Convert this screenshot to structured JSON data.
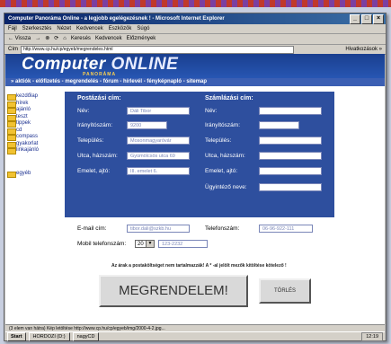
{
  "window": {
    "title": "Computer Panoráma Online - a legjobb egelégezésnek ! - Microsoft Internet Explorer",
    "buttons": [
      "_",
      "□",
      "×"
    ]
  },
  "menu": [
    "Fájl",
    "Szerkesztés",
    "Nézet",
    "Kedvencek",
    "Eszközök",
    "Súgó"
  ],
  "toolbar": [
    "← Vissza",
    "→",
    "⊗",
    "⟳",
    "⌂",
    "Keresés",
    "Kedvencek",
    "Előzmények"
  ],
  "address": {
    "label": "Cím",
    "value": "http://www.cp.hu/cp/egyeb/megrendeles.html",
    "links_label": "Hivatkozások »"
  },
  "banner": {
    "logo_main": "Computer",
    "logo_online": "ONLINE",
    "logo_sub": "PANORÁMA"
  },
  "navbar": "» aktiók - előfizetés - megrendelés - fórum - hírlevél - fényképnapló - sitemap",
  "sidebar": {
    "items": [
      "kezdőlap",
      "hírek",
      "ajánló",
      "teszt",
      "tippek",
      "cd",
      "compass",
      "gyakorlat",
      "linkajánló",
      "egyéb"
    ]
  },
  "form": {
    "postal": {
      "title": "Postázási cím:",
      "fields": [
        {
          "label": "Név:",
          "value": "Dáli Tibor"
        },
        {
          "label": "Irányítószám:",
          "value": "9200"
        },
        {
          "label": "Település:",
          "value": "Mosonmagyaróvár"
        },
        {
          "label": "Utca, házszám:",
          "value": "Gyümölcsös utca 69"
        },
        {
          "label": "Emelet, ajtó:",
          "value": "III. emelet 6."
        }
      ]
    },
    "billing": {
      "title": "Számlázási cím:",
      "fields": [
        {
          "label": "Név:",
          "value": ""
        },
        {
          "label": "Irányítószám:",
          "value": ""
        },
        {
          "label": "Település:",
          "value": ""
        },
        {
          "label": "Utca, házszám:",
          "value": ""
        },
        {
          "label": "Emelet, ajtó:",
          "value": ""
        },
        {
          "label": "Ügyintéző neve:",
          "value": ""
        }
      ]
    },
    "email": {
      "label": "E-mail cím:",
      "value": "tibor.dali@szkb.hu"
    },
    "phone": {
      "label": "Telefonszám:",
      "value": "06-96-922-111"
    },
    "mobile": {
      "label": "Mobil telefonszám:",
      "prefix": "20",
      "value": "123-2232"
    },
    "note": "Az árak a postaköltséget nem tartalmazzák! A * -al jelölt mezők kitöltése kötelező !",
    "submit_label": "MEGRENDELEM!",
    "reset_label": "TÖRLÉS"
  },
  "status": "(3 elem van hátra) Kép letöltése http://www.cp.hu/cp/egyeb/img/2000-4-2.jpg...",
  "taskbar": {
    "start": "Start",
    "tasks": [
      "HORDOZI (D:)",
      "nagyCD"
    ],
    "clock": "12:19"
  }
}
